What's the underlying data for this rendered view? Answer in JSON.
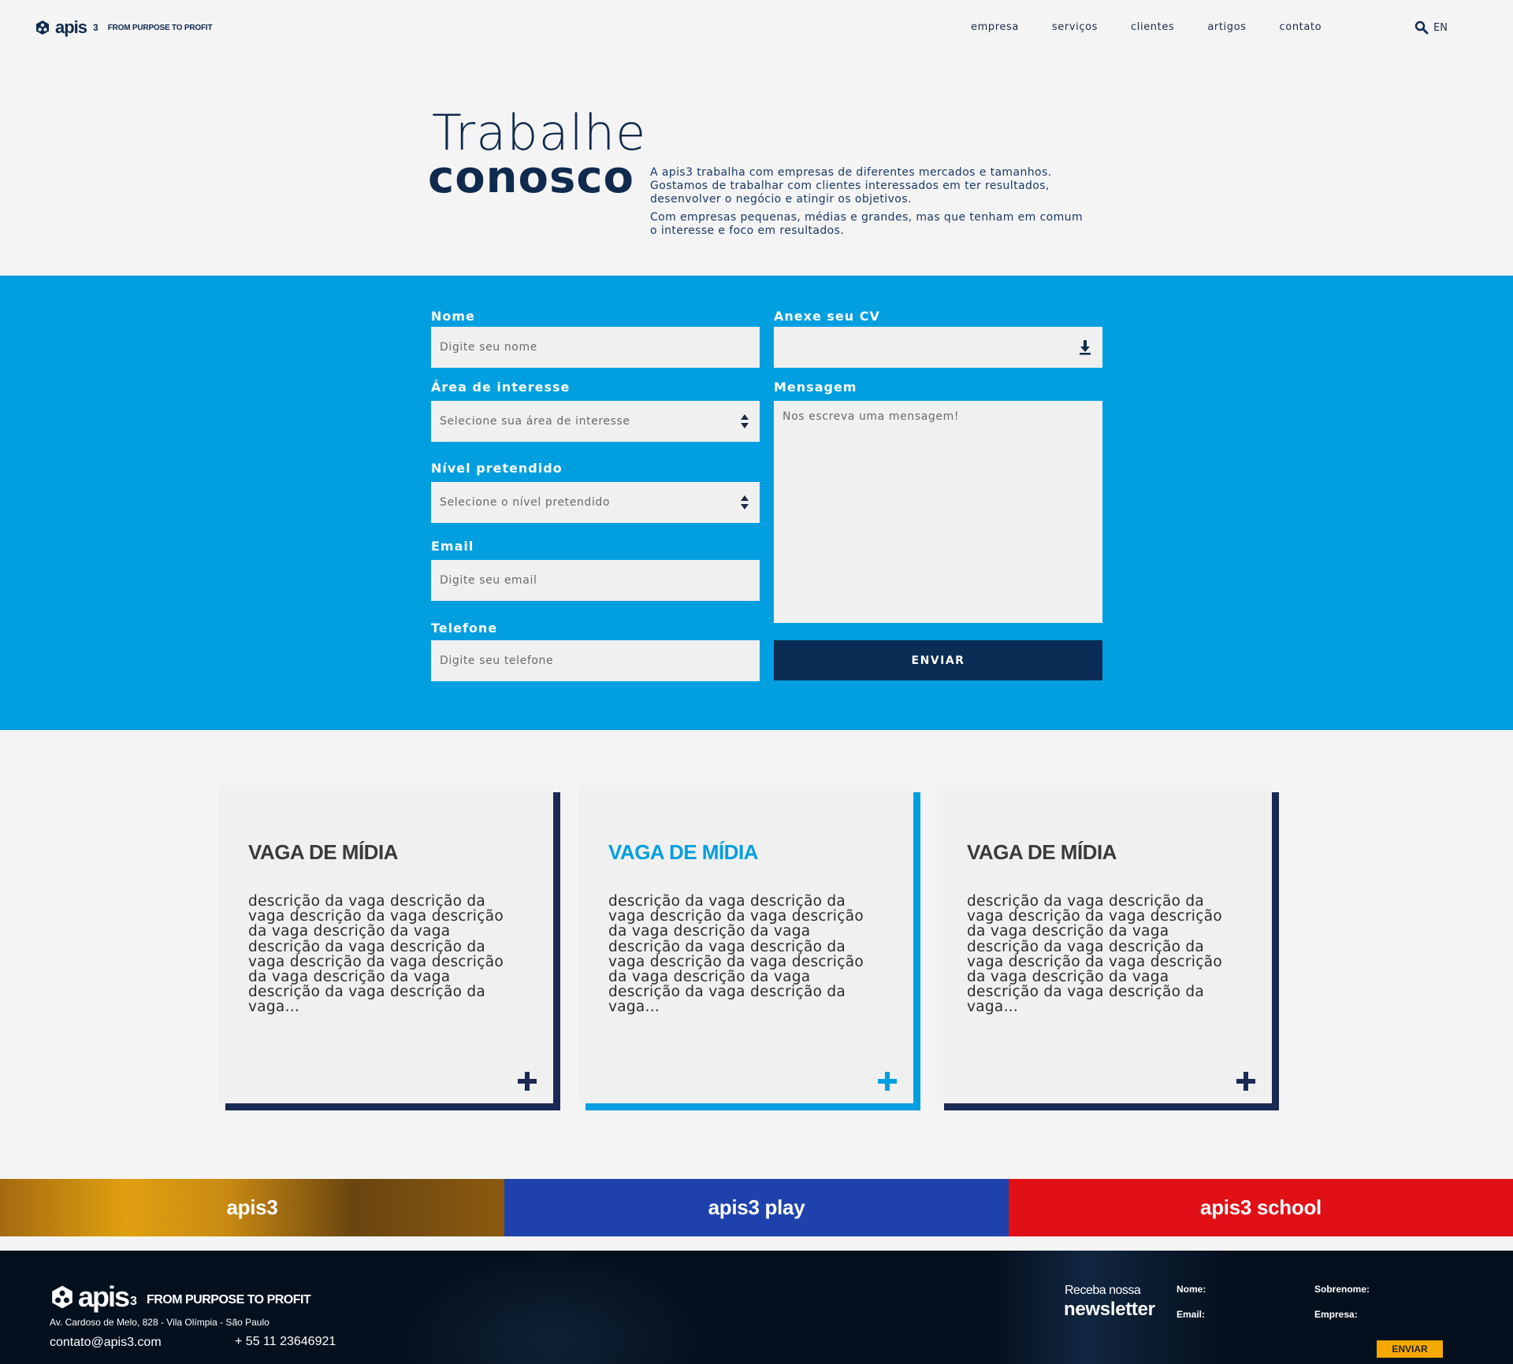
{
  "header": {
    "logo_name": "apis",
    "logo_sub": "3",
    "logo_tagline": "FROM PURPOSE TO PROFIT",
    "nav": [
      "empresa",
      "serviços",
      "clientes",
      "artigos",
      "contato"
    ],
    "language": "EN"
  },
  "hero": {
    "title_light": "Trabalhe",
    "title_bold": "conosco",
    "paragraph_1": "A apis3 trabalha com empresas de diferentes mercados e tamanhos. Gostamos de trabalhar com clientes interessados em ter resultados, desenvolver o negócio e atingir os objetivos.",
    "paragraph_2": "Com empresas pequenas, médias e grandes, mas que tenham em comum o interesse e foco em resultados."
  },
  "form": {
    "nome_label": "Nome",
    "nome_placeholder": "Digite seu nome",
    "area_label": "Área de interesse",
    "area_selected": "Selecione sua área de interesse",
    "nivel_label": "Nível pretendido",
    "nivel_selected": "Selecione o nível pretendido",
    "email_label": "Email",
    "email_placeholder": "Digite seu email",
    "telefone_label": "Telefone",
    "telefone_placeholder": "Digite seu telefone",
    "cv_label": "Anexe seu CV",
    "mensagem_label": "Mensagem",
    "mensagem_placeholder": "Nos escreva uma mensagem!",
    "submit_label": "ENVIAR"
  },
  "jobs": [
    {
      "title": "VAGA DE MÍDIA",
      "description": "descrição da vaga descrição da vaga descrição da vaga descrição da vaga descrição da vaga descrição da vaga descrição da vaga descrição da vaga descrição da vaga descrição da vaga descrição da vaga descrição da vaga...",
      "accent": "#1b2a55",
      "title_color": "#3a3a3a"
    },
    {
      "title": "VAGA DE MÍDIA",
      "description": "descrição da vaga descrição da vaga descrição da vaga descrição da vaga descrição da vaga descrição da vaga descrição da vaga descrição da vaga descrição da vaga descrição da vaga descrição da vaga descrição da vaga...",
      "accent": "#029fe0",
      "title_color": "#029fe0"
    },
    {
      "title": "VAGA DE MÍDIA",
      "description": "descrição da vaga descrição da vaga descrição da vaga descrição da vaga descrição da vaga descrição da vaga descrição da vaga descrição da vaga descrição da vaga descrição da vaga descrição da vaga descrição da vaga...",
      "accent": "#1b2a55",
      "title_color": "#3a3a3a"
    }
  ],
  "brands": [
    "apis3",
    "apis3 play",
    "apis3 school"
  ],
  "footer": {
    "logo_name": "apis",
    "logo_sub": "3",
    "logo_tagline": "FROM PURPOSE TO PROFIT",
    "address": "Av. Cardoso de Melo, 828 - Vila Olímpia - São Paulo",
    "email": "contato@apis3.com",
    "phone": "+ 55 11 23646921",
    "newsletter_small": "Receba nossa",
    "newsletter_big": "newsletter",
    "nl_nome": "Nome:",
    "nl_sobrenome": "Sobrenome:",
    "nl_email": "Email:",
    "nl_empresa": "Empresa:",
    "nl_submit": "ENVIAR"
  },
  "colors": {
    "brand_navy": "#0f2a4d",
    "form_blue": "#029fe0",
    "button_navy": "#0b2c54",
    "play_blue": "#1e41ac",
    "school_red": "#e10f16",
    "newsletter_yellow": "#f7a800"
  }
}
